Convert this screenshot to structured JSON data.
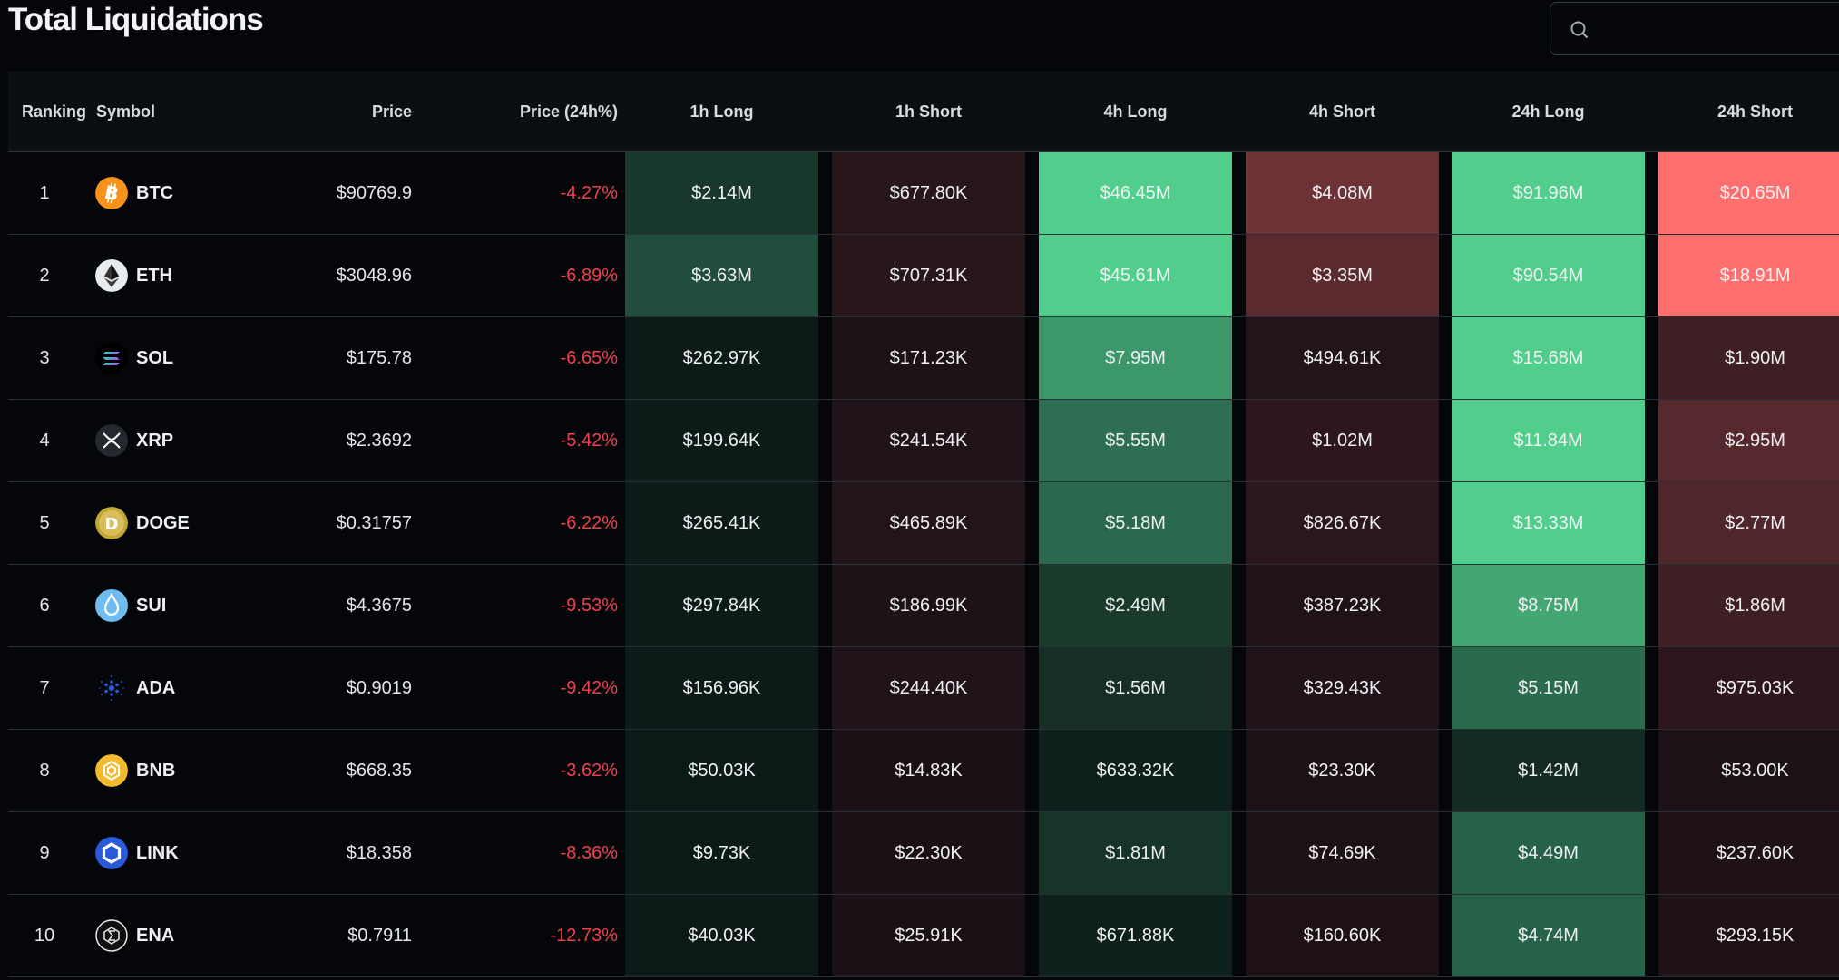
{
  "page": {
    "title": "Total Liquidations"
  },
  "search": {
    "icon": "search-icon",
    "placeholder": "",
    "value": ""
  },
  "table": {
    "columns": [
      "Ranking",
      "Symbol",
      "Price",
      "Price (24h%)",
      "1h Long",
      "1h Short",
      "4h Long",
      "4h Short",
      "24h Long",
      "24h Short"
    ],
    "rows": [
      {
        "rank": "1",
        "symbol": "BTC",
        "icon": "bitcoin-icon",
        "price": "$90769.9",
        "change_24h": "-4.27%",
        "h1_long": "$2.14M",
        "h1_short": "$677.80K",
        "h4_long": "$46.45M",
        "h4_short": "$4.08M",
        "h24_long": "$91.96M",
        "h24_short": "$20.65M",
        "colors": [
          "#19382c",
          "#27161a",
          "#51cd8c",
          "#6c3236",
          "#51cd8c",
          "#fd6e6e"
        ]
      },
      {
        "rank": "2",
        "symbol": "ETH",
        "icon": "ethereum-icon",
        "price": "$3048.96",
        "change_24h": "-6.89%",
        "h1_long": "$3.63M",
        "h1_short": "$707.31K",
        "h4_long": "$45.61M",
        "h4_short": "$3.35M",
        "h24_long": "$90.54M",
        "h24_short": "$18.91M",
        "colors": [
          "#214d3c",
          "#27161a",
          "#51cd8c",
          "#5b2a2f",
          "#51cd8c",
          "#fd6e6e"
        ]
      },
      {
        "rank": "3",
        "symbol": "SOL",
        "icon": "solana-icon",
        "price": "$175.78",
        "change_24h": "-6.65%",
        "h1_long": "$262.97K",
        "h1_short": "$171.23K",
        "h4_long": "$7.95M",
        "h4_short": "$494.61K",
        "h24_long": "$15.68M",
        "h24_short": "$1.90M",
        "colors": [
          "#0c1b18",
          "#1d1216",
          "#3c976b",
          "#22141a",
          "#51cd8c",
          "#3e1f23"
        ]
      },
      {
        "rank": "4",
        "symbol": "XRP",
        "icon": "xrp-icon",
        "price": "$2.3692",
        "change_24h": "-5.42%",
        "h1_long": "$199.64K",
        "h1_short": "$241.54K",
        "h4_long": "$5.55M",
        "h4_short": "$1.02M",
        "h24_long": "$11.84M",
        "h24_short": "$2.95M",
        "colors": [
          "#0c1b18",
          "#20131a",
          "#2e6f53",
          "#2d171c",
          "#51cd8c",
          "#55292d"
        ]
      },
      {
        "rank": "5",
        "symbol": "DOGE",
        "icon": "dogecoin-icon",
        "price": "$0.31757",
        "change_24h": "-6.22%",
        "h1_long": "$265.41K",
        "h1_short": "$465.89K",
        "h4_long": "$5.18M",
        "h4_short": "$826.67K",
        "h24_long": "$13.33M",
        "h24_short": "$2.77M",
        "colors": [
          "#0c1b18",
          "#23141a",
          "#2a694d",
          "#2c171c",
          "#51cd8c",
          "#4f272b"
        ]
      },
      {
        "rank": "6",
        "symbol": "SUI",
        "icon": "sui-icon",
        "price": "$4.3675",
        "change_24h": "-9.53%",
        "h1_long": "$297.84K",
        "h1_short": "$186.99K",
        "h4_long": "$2.49M",
        "h4_short": "$387.23K",
        "h24_long": "$8.75M",
        "h24_short": "$1.86M",
        "colors": [
          "#0c1b18",
          "#1d1216",
          "#1a3a2c",
          "#201318",
          "#43a673",
          "#3e1f23"
        ]
      },
      {
        "rank": "7",
        "symbol": "ADA",
        "icon": "cardano-icon",
        "price": "$0.9019",
        "change_24h": "-9.42%",
        "h1_long": "$156.96K",
        "h1_short": "$244.40K",
        "h4_long": "$1.56M",
        "h4_short": "$329.43K",
        "h24_long": "$5.15M",
        "h24_short": "$975.03K",
        "colors": [
          "#0c1b18",
          "#20131a",
          "#172e25",
          "#20131a",
          "#2a6b4e",
          "#2d171c"
        ]
      },
      {
        "rank": "8",
        "symbol": "BNB",
        "icon": "bnb-icon",
        "price": "$668.35",
        "change_24h": "-3.62%",
        "h1_long": "$50.03K",
        "h1_short": "$14.83K",
        "h4_long": "$633.32K",
        "h4_short": "$23.30K",
        "h24_long": "$1.42M",
        "h24_short": "$53.00K",
        "colors": [
          "#0b1a17",
          "#1b1015",
          "#0e201b",
          "#1c1116",
          "#142b23",
          "#1c1116"
        ]
      },
      {
        "rank": "9",
        "symbol": "LINK",
        "icon": "chainlink-icon",
        "price": "$18.358",
        "change_24h": "-8.36%",
        "h1_long": "$9.73K",
        "h1_short": "$22.30K",
        "h4_long": "$1.81M",
        "h4_short": "$74.69K",
        "h24_long": "$4.49M",
        "h24_short": "$237.60K",
        "colors": [
          "#0b1a17",
          "#1b1015",
          "#163428",
          "#1c1116",
          "#26614a",
          "#1f1217"
        ]
      },
      {
        "rank": "10",
        "symbol": "ENA",
        "icon": "ethena-icon",
        "price": "$0.7911",
        "change_24h": "-12.73%",
        "h1_long": "$40.03K",
        "h1_short": "$25.91K",
        "h4_long": "$671.88K",
        "h4_short": "$160.60K",
        "h24_long": "$4.74M",
        "h24_short": "$293.15K",
        "colors": [
          "#0b1a17",
          "#1b1015",
          "#0e201b",
          "#1d1116",
          "#27634b",
          "#1f1217"
        ]
      }
    ]
  }
}
